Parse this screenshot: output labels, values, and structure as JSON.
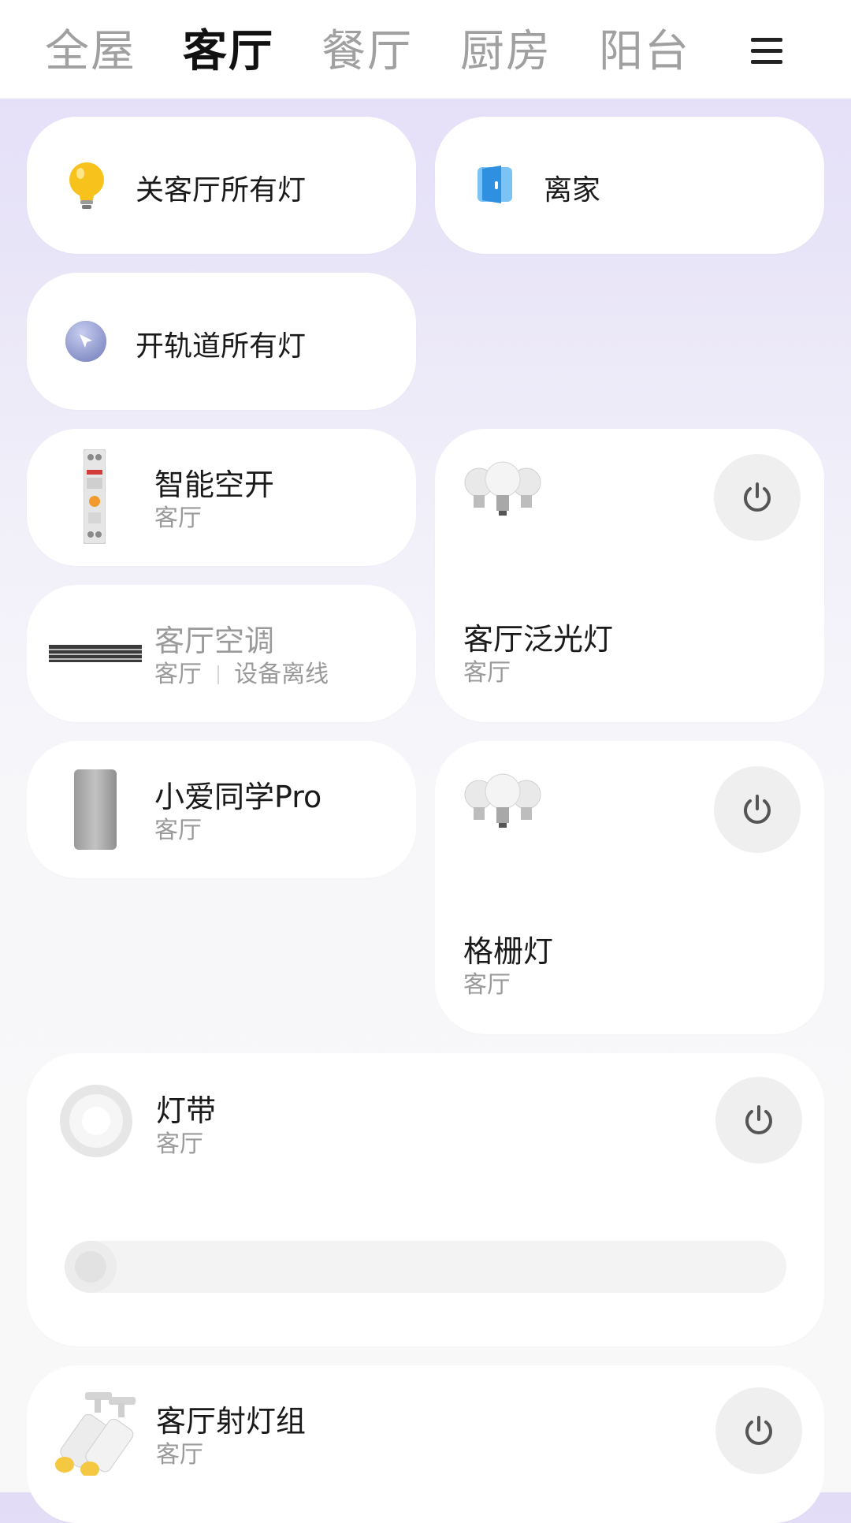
{
  "tabs": [
    {
      "label": "全屋",
      "active": false
    },
    {
      "label": "客厅",
      "active": true
    },
    {
      "label": "餐厅",
      "active": false
    },
    {
      "label": "厨房",
      "active": false
    },
    {
      "label": "阳台",
      "active": false
    }
  ],
  "menu_icon": "hamburger-icon",
  "scenes": [
    {
      "label": "关客厅所有灯",
      "icon": "bulb-icon"
    },
    {
      "label": "离家",
      "icon": "door-icon"
    },
    {
      "label": "开轨道所有灯",
      "icon": "cursor-icon"
    }
  ],
  "devices": {
    "breaker": {
      "name": "智能空开",
      "room": "客厅",
      "icon": "breaker-icon"
    },
    "ac": {
      "name": "客厅空调",
      "room": "客厅",
      "status": "设备离线",
      "icon": "ac-icon"
    },
    "speaker": {
      "name": "小爱同学Pro",
      "room": "客厅",
      "icon": "speaker-icon"
    },
    "floodlight": {
      "name": "客厅泛光灯",
      "room": "客厅",
      "icon": "bulbs-icon"
    },
    "grille": {
      "name": "格栅灯",
      "room": "客厅",
      "icon": "bulbs-icon"
    },
    "strip": {
      "name": "灯带",
      "room": "客厅",
      "icon": "light-ring-icon",
      "brightness": 0.0
    },
    "spot": {
      "name": "客厅射灯组",
      "room": "客厅",
      "icon": "spotlight-icon"
    }
  },
  "colors": {
    "accent_bulb": "#f7c21b",
    "door": "#3a9be8",
    "power_bg": "#efefef"
  }
}
